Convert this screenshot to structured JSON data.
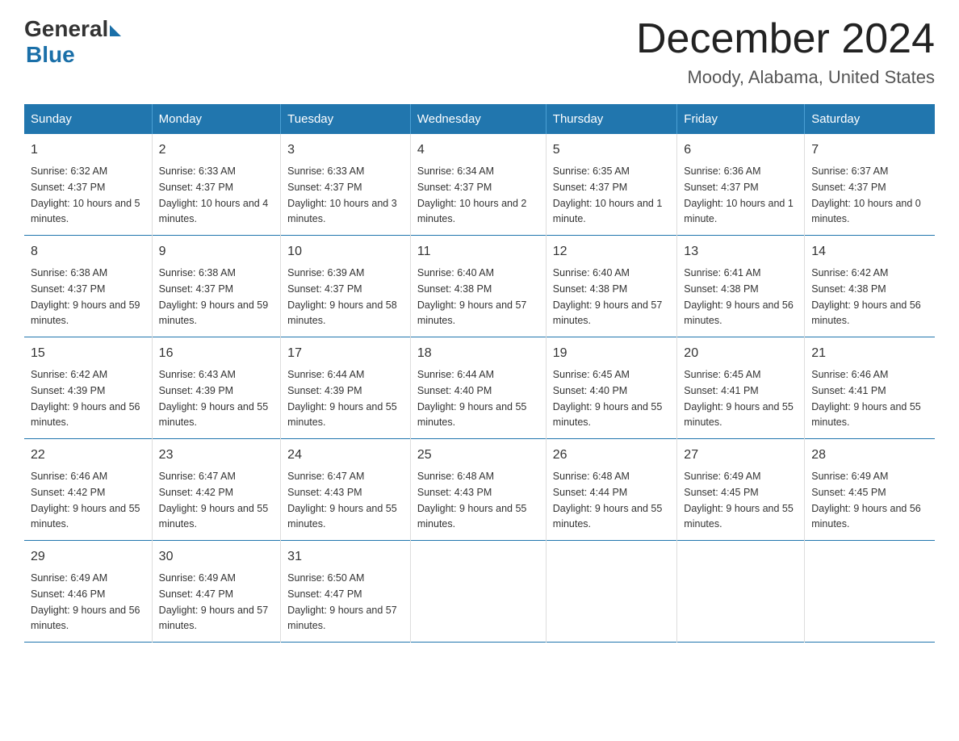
{
  "logo": {
    "general_text": "General",
    "blue_text": "Blue"
  },
  "title": "December 2024",
  "subtitle": "Moody, Alabama, United States",
  "days_of_week": [
    "Sunday",
    "Monday",
    "Tuesday",
    "Wednesday",
    "Thursday",
    "Friday",
    "Saturday"
  ],
  "weeks": [
    [
      {
        "day": "1",
        "sunrise": "6:32 AM",
        "sunset": "4:37 PM",
        "daylight": "10 hours and 5 minutes."
      },
      {
        "day": "2",
        "sunrise": "6:33 AM",
        "sunset": "4:37 PM",
        "daylight": "10 hours and 4 minutes."
      },
      {
        "day": "3",
        "sunrise": "6:33 AM",
        "sunset": "4:37 PM",
        "daylight": "10 hours and 3 minutes."
      },
      {
        "day": "4",
        "sunrise": "6:34 AM",
        "sunset": "4:37 PM",
        "daylight": "10 hours and 2 minutes."
      },
      {
        "day": "5",
        "sunrise": "6:35 AM",
        "sunset": "4:37 PM",
        "daylight": "10 hours and 1 minute."
      },
      {
        "day": "6",
        "sunrise": "6:36 AM",
        "sunset": "4:37 PM",
        "daylight": "10 hours and 1 minute."
      },
      {
        "day": "7",
        "sunrise": "6:37 AM",
        "sunset": "4:37 PM",
        "daylight": "10 hours and 0 minutes."
      }
    ],
    [
      {
        "day": "8",
        "sunrise": "6:38 AM",
        "sunset": "4:37 PM",
        "daylight": "9 hours and 59 minutes."
      },
      {
        "day": "9",
        "sunrise": "6:38 AM",
        "sunset": "4:37 PM",
        "daylight": "9 hours and 59 minutes."
      },
      {
        "day": "10",
        "sunrise": "6:39 AM",
        "sunset": "4:37 PM",
        "daylight": "9 hours and 58 minutes."
      },
      {
        "day": "11",
        "sunrise": "6:40 AM",
        "sunset": "4:38 PM",
        "daylight": "9 hours and 57 minutes."
      },
      {
        "day": "12",
        "sunrise": "6:40 AM",
        "sunset": "4:38 PM",
        "daylight": "9 hours and 57 minutes."
      },
      {
        "day": "13",
        "sunrise": "6:41 AM",
        "sunset": "4:38 PM",
        "daylight": "9 hours and 56 minutes."
      },
      {
        "day": "14",
        "sunrise": "6:42 AM",
        "sunset": "4:38 PM",
        "daylight": "9 hours and 56 minutes."
      }
    ],
    [
      {
        "day": "15",
        "sunrise": "6:42 AM",
        "sunset": "4:39 PM",
        "daylight": "9 hours and 56 minutes."
      },
      {
        "day": "16",
        "sunrise": "6:43 AM",
        "sunset": "4:39 PM",
        "daylight": "9 hours and 55 minutes."
      },
      {
        "day": "17",
        "sunrise": "6:44 AM",
        "sunset": "4:39 PM",
        "daylight": "9 hours and 55 minutes."
      },
      {
        "day": "18",
        "sunrise": "6:44 AM",
        "sunset": "4:40 PM",
        "daylight": "9 hours and 55 minutes."
      },
      {
        "day": "19",
        "sunrise": "6:45 AM",
        "sunset": "4:40 PM",
        "daylight": "9 hours and 55 minutes."
      },
      {
        "day": "20",
        "sunrise": "6:45 AM",
        "sunset": "4:41 PM",
        "daylight": "9 hours and 55 minutes."
      },
      {
        "day": "21",
        "sunrise": "6:46 AM",
        "sunset": "4:41 PM",
        "daylight": "9 hours and 55 minutes."
      }
    ],
    [
      {
        "day": "22",
        "sunrise": "6:46 AM",
        "sunset": "4:42 PM",
        "daylight": "9 hours and 55 minutes."
      },
      {
        "day": "23",
        "sunrise": "6:47 AM",
        "sunset": "4:42 PM",
        "daylight": "9 hours and 55 minutes."
      },
      {
        "day": "24",
        "sunrise": "6:47 AM",
        "sunset": "4:43 PM",
        "daylight": "9 hours and 55 minutes."
      },
      {
        "day": "25",
        "sunrise": "6:48 AM",
        "sunset": "4:43 PM",
        "daylight": "9 hours and 55 minutes."
      },
      {
        "day": "26",
        "sunrise": "6:48 AM",
        "sunset": "4:44 PM",
        "daylight": "9 hours and 55 minutes."
      },
      {
        "day": "27",
        "sunrise": "6:49 AM",
        "sunset": "4:45 PM",
        "daylight": "9 hours and 55 minutes."
      },
      {
        "day": "28",
        "sunrise": "6:49 AM",
        "sunset": "4:45 PM",
        "daylight": "9 hours and 56 minutes."
      }
    ],
    [
      {
        "day": "29",
        "sunrise": "6:49 AM",
        "sunset": "4:46 PM",
        "daylight": "9 hours and 56 minutes."
      },
      {
        "day": "30",
        "sunrise": "6:49 AM",
        "sunset": "4:47 PM",
        "daylight": "9 hours and 57 minutes."
      },
      {
        "day": "31",
        "sunrise": "6:50 AM",
        "sunset": "4:47 PM",
        "daylight": "9 hours and 57 minutes."
      },
      {
        "day": "",
        "sunrise": "",
        "sunset": "",
        "daylight": ""
      },
      {
        "day": "",
        "sunrise": "",
        "sunset": "",
        "daylight": ""
      },
      {
        "day": "",
        "sunrise": "",
        "sunset": "",
        "daylight": ""
      },
      {
        "day": "",
        "sunrise": "",
        "sunset": "",
        "daylight": ""
      }
    ]
  ],
  "labels": {
    "sunrise": "Sunrise:",
    "sunset": "Sunset:",
    "daylight": "Daylight:"
  }
}
